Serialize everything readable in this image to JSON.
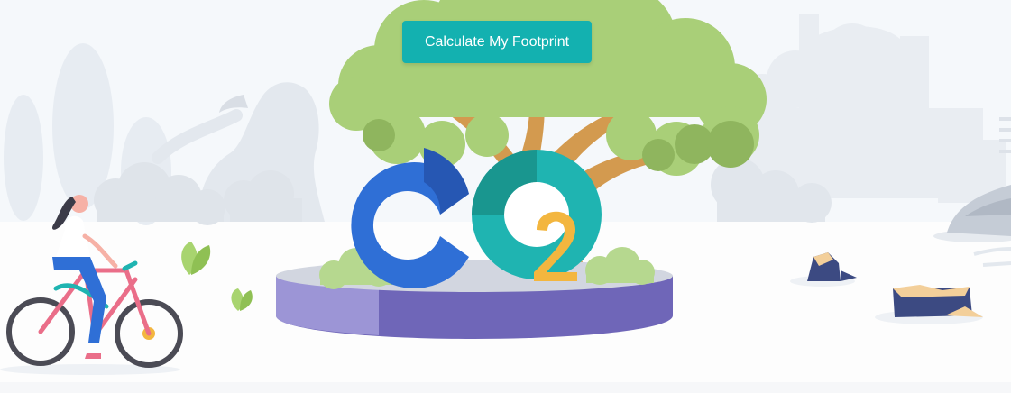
{
  "hero": {
    "cta_label": "Calculate My Footprint",
    "logo_main_text": "CO",
    "logo_subscript": "2"
  },
  "colors": {
    "accent": "#13b1b0",
    "canopy": "#a9cf78",
    "trunk": "#d39a4f",
    "co_blue": "#2f6fd6",
    "co_teal": "#1fb4b1",
    "subscript": "#f3b63f",
    "platform": "#6f66b8"
  },
  "icons": [
    "tree-icon",
    "co2-logo-icon",
    "cyclist-icon",
    "merlion-icon",
    "factory-icon",
    "tree-stump-icon",
    "rock-icon",
    "leaf-icon"
  ]
}
